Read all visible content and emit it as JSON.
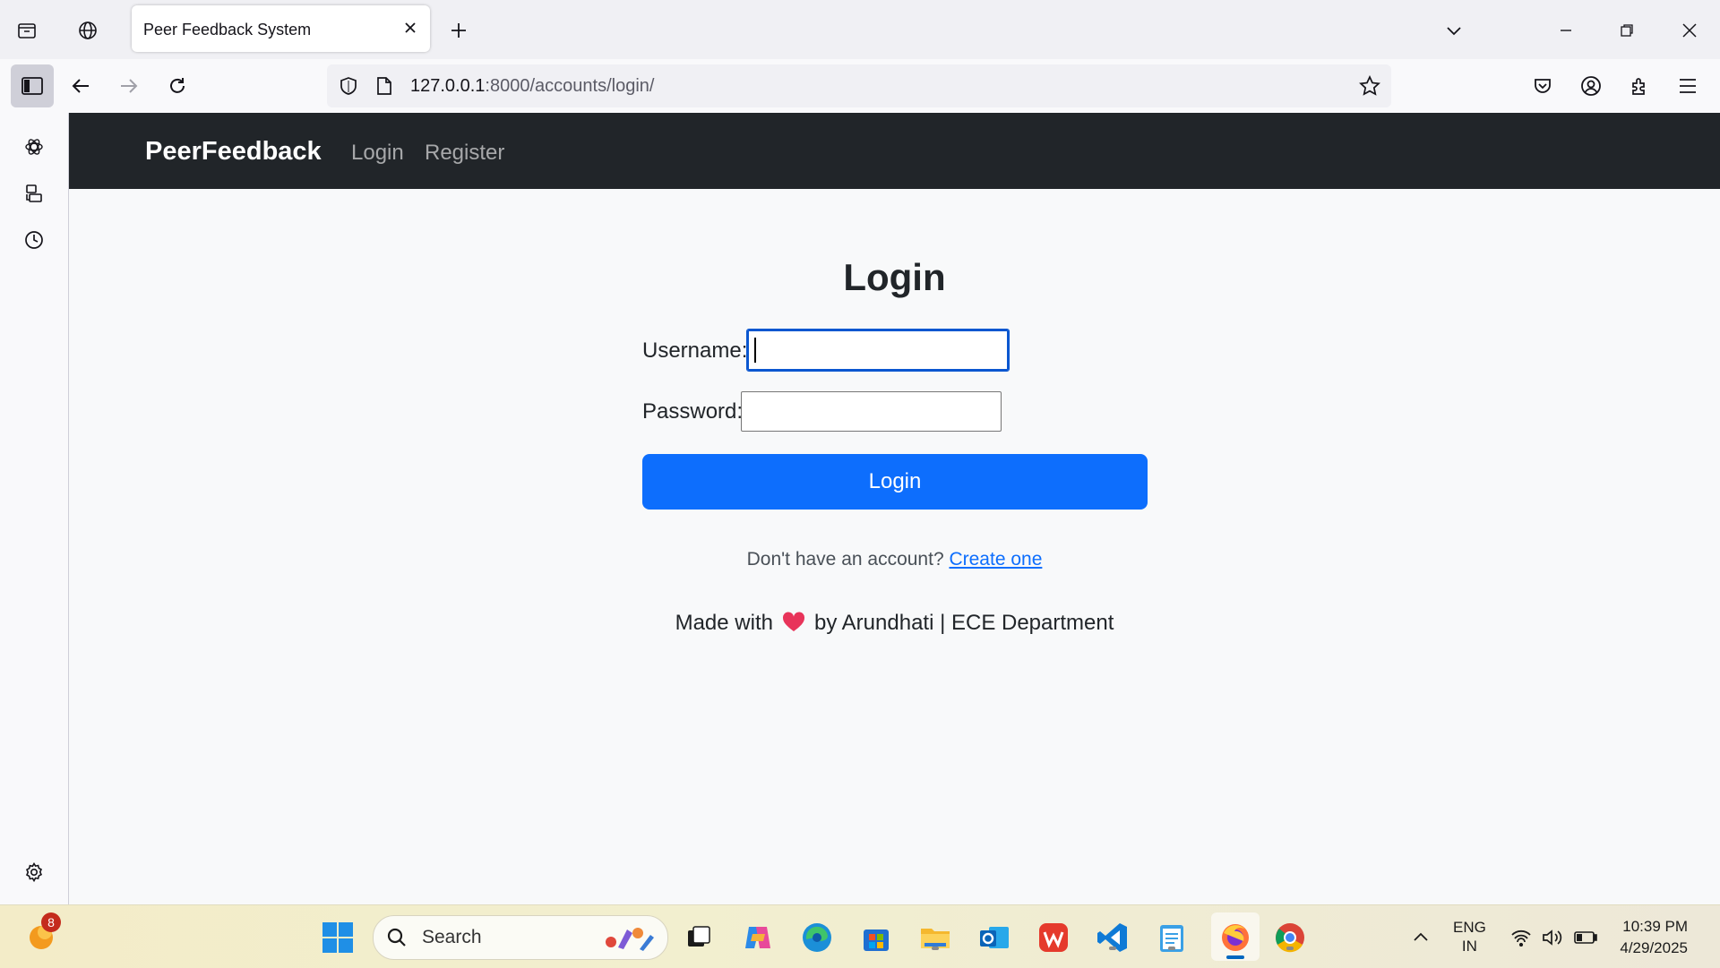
{
  "browser": {
    "tab_title": "Peer Feedback System",
    "url_host": "127.0.0.1",
    "url_rest": ":8000/accounts/login/"
  },
  "site": {
    "brand": "PeerFeedback",
    "nav": {
      "login": "Login",
      "register": "Register"
    }
  },
  "form": {
    "title": "Login",
    "username_label": "Username:",
    "username_value": "",
    "password_label": "Password:",
    "password_value": "",
    "submit_label": "Login",
    "signup_prompt": "Don't have an account?",
    "signup_link": "Create one"
  },
  "footer": {
    "made_with": "Made with",
    "by_line": "by Arundhati | ECE Department"
  },
  "taskbar": {
    "search_placeholder": "Search",
    "notification_count": "8",
    "language_top": "ENG",
    "language_bottom": "IN",
    "time": "10:39 PM",
    "date": "4/29/2025"
  },
  "colors": {
    "navbar_bg": "#212529",
    "primary": "#0d6efd",
    "heart": "#e8345a"
  }
}
